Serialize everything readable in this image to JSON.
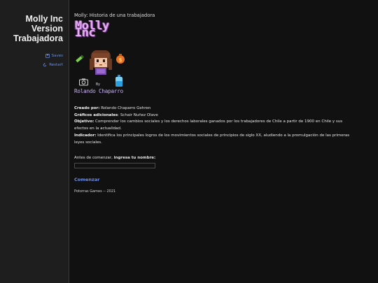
{
  "sidebar": {
    "story_title": "Molly Inc Version Trabajadora",
    "saves_label": "Saves",
    "restart_label": "Restart"
  },
  "passage": {
    "header": "Molly: Historia de una trabajadora",
    "cover": {
      "title_art": "Molly Inc",
      "by_art": "By",
      "author_art": "Rolando Chaparro"
    },
    "credits": [
      {
        "label": "Creado por:",
        "value": " Rolando Chaparro Gehren"
      },
      {
        "label": "Gráficos adicionales",
        "value": ": Schair Nuñez Olave"
      },
      {
        "label": "Objetivo:",
        "value": " Comprender los cambios sociales y los derechos laborales ganados por los trabajadores de Chile a partir de 1900 en Chile y sus efectos en la actualidad."
      },
      {
        "label": "Indicador:",
        "value": " Identifica los principales logros de los movimientos sociales de principios de siglo XX, aludiendo a la promulgación de las primeras leyes sociales."
      }
    ],
    "name_prompt_prefix": "Antes de comenzar, ",
    "name_prompt_bold": "ingresa tu nombre:",
    "name_input_value": "",
    "start_label": "Comenzar",
    "footer": "Potorras Games -- 2021"
  },
  "colors": {
    "background": "#111111",
    "sidebar": "#1e1e1e",
    "link": "#6f8fe6",
    "title_art": "#e4aef0"
  },
  "icons": [
    "save-icon",
    "restart-icon",
    "pencil-icon",
    "money-bag-icon",
    "camera-icon",
    "water-bottle-icon",
    "molly-character"
  ]
}
